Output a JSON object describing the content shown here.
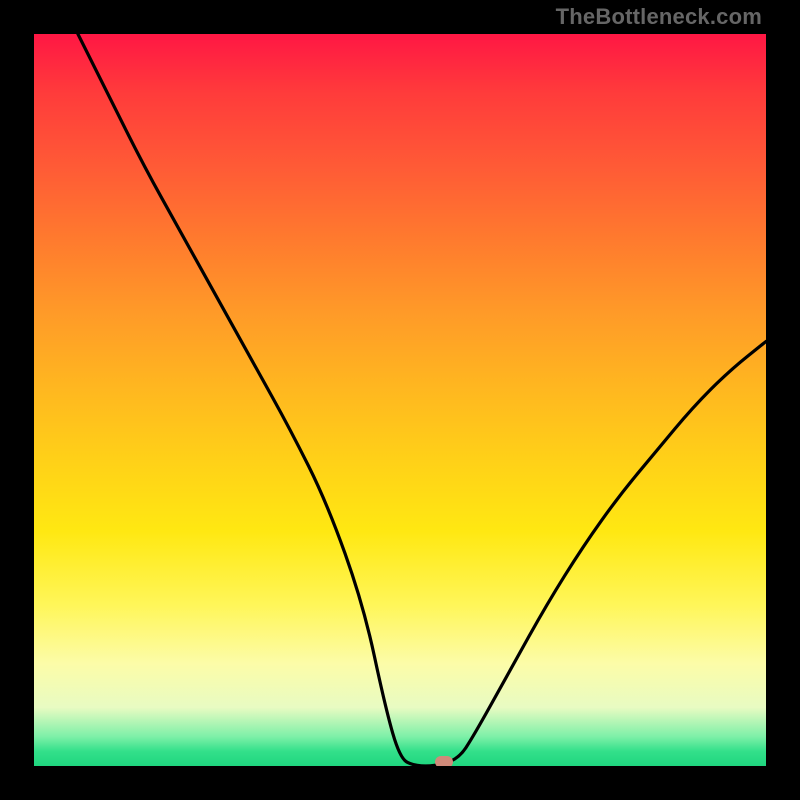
{
  "watermark": "TheBottleneck.com",
  "chart_data": {
    "type": "line",
    "title": "",
    "xlabel": "",
    "ylabel": "",
    "xlim": [
      0,
      100
    ],
    "ylim": [
      0,
      100
    ],
    "series": [
      {
        "name": "curve",
        "x": [
          6,
          10,
          15,
          20,
          25,
          30,
          35,
          40,
          45,
          48,
          50,
          52,
          55,
          58,
          60,
          65,
          70,
          75,
          80,
          85,
          90,
          95,
          100
        ],
        "y": [
          100,
          92,
          82,
          73,
          64,
          55,
          46,
          36,
          22,
          8,
          1,
          0,
          0,
          1,
          4,
          13,
          22,
          30,
          37,
          43,
          49,
          54,
          58
        ]
      }
    ],
    "marker": {
      "x": 56,
      "y": 0.5,
      "color": "#d08a7a"
    },
    "background": "vertical-gradient-red-to-green"
  }
}
